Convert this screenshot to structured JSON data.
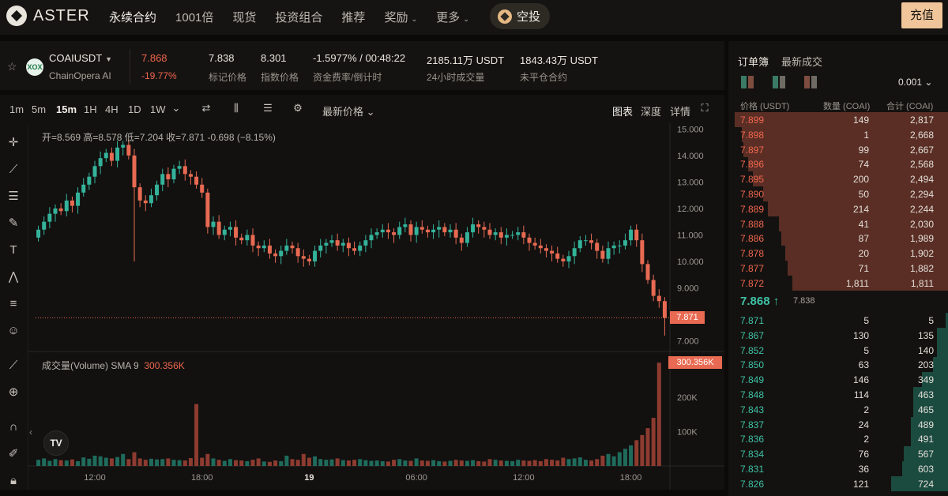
{
  "nav": {
    "logo": "ASTER",
    "items": [
      "永续合约",
      "1001倍",
      "现货",
      "投资组合",
      "推荐",
      "奖励",
      "更多"
    ],
    "airdrop": "空投",
    "deposit": "充值"
  },
  "ticker": {
    "symbol": "COAIUSDT",
    "name": "ChainOpera AI",
    "coin_icon": "XOX",
    "last_price": "7.868",
    "change_pct": "-19.77%",
    "mark_price": "7.838",
    "mark_label": "标记价格",
    "index_price": "8.301",
    "index_label": "指数价格",
    "funding": "-1.5977% / 00:48:22",
    "funding_label": "资金费率/倒计时",
    "volume_24h": "2185.11万 USDT",
    "volume_label": "24小时成交量",
    "open_interest": "1843.43万 USDT",
    "oi_label": "未平仓合约"
  },
  "toolbar": {
    "timeframes": [
      "1m",
      "5m",
      "15m",
      "1H",
      "4H",
      "1D",
      "1W"
    ],
    "active_timeframe": "15m",
    "price_type": "最新价格",
    "views": [
      "图表",
      "深度",
      "详情"
    ]
  },
  "chart": {
    "ohlc_text": "开=8.569 高=8.578 低=7.204 收=7.871 -0.698 (−8.15%)",
    "volume_text": "成交量(Volume) SMA 9",
    "volume_value": "300.356K",
    "last_price_tag": "7.871",
    "volume_tag": "300.356K"
  },
  "chart_data": {
    "type": "candlestick",
    "y_ticks": [
      "15.000",
      "14.000",
      "13.000",
      "12.000",
      "11.000",
      "10.000",
      "9.000",
      "7.000"
    ],
    "y_tick_values": [
      15,
      14,
      13,
      12,
      11,
      10,
      9,
      7
    ],
    "ylim": [
      6.6,
      15.1
    ],
    "x_ticks": [
      "12:00",
      "18:00",
      "19",
      "06:00",
      "12:00",
      "18:00"
    ],
    "x_tick_index": [
      10,
      29,
      48,
      67,
      86,
      105
    ],
    "vol_ticks": [
      "200K",
      "100K"
    ],
    "vol_tick_values": [
      200000,
      100000
    ],
    "vol_max": 310000,
    "closes": [
      11.2,
      11.5,
      11.8,
      12.0,
      11.9,
      12.3,
      12.1,
      12.6,
      12.9,
      13.2,
      13.6,
      13.9,
      14.1,
      13.8,
      14.3,
      14.4,
      14.0,
      12.8,
      12.3,
      12.2,
      12.5,
      12.9,
      13.3,
      13.1,
      13.5,
      13.6,
      13.3,
      13.2,
      12.9,
      12.6,
      11.3,
      11.5,
      11.0,
      11.2,
      11.3,
      10.9,
      10.8,
      11.0,
      10.6,
      10.5,
      10.6,
      10.3,
      10.2,
      10.4,
      10.6,
      10.5,
      10.2,
      10.1,
      10.0,
      10.4,
      10.6,
      10.7,
      10.8,
      10.6,
      10.7,
      10.5,
      10.4,
      10.6,
      10.8,
      11.0,
      11.1,
      11.2,
      11.1,
      11.0,
      11.3,
      11.4,
      11.0,
      11.3,
      11.2,
      11.1,
      11.2,
      11.3,
      11.1,
      11.2,
      10.9,
      10.7,
      11.1,
      11.4,
      11.3,
      11.2,
      11.0,
      11.1,
      10.9,
      11.0,
      11.0,
      11.1,
      10.9,
      10.7,
      10.6,
      10.5,
      10.4,
      10.3,
      10.1,
      10.0,
      10.2,
      10.5,
      10.8,
      10.8,
      10.7,
      10.4,
      10.1,
      10.5,
      10.6,
      10.6,
      10.8,
      11.2,
      10.8,
      9.9,
      9.3,
      8.7,
      8.5,
      7.87
    ],
    "volumes": [
      18000,
      22000,
      15000,
      20000,
      17000,
      16000,
      19000,
      14000,
      25000,
      21000,
      30000,
      28000,
      24000,
      22000,
      26000,
      35000,
      20000,
      40000,
      22000,
      18000,
      21000,
      19000,
      20000,
      22000,
      18000,
      17000,
      16000,
      23000,
      180000,
      24000,
      35000,
      22000,
      18000,
      15000,
      20000,
      17000,
      16000,
      14000,
      18000,
      22000,
      13000,
      12000,
      16000,
      14000,
      30000,
      20000,
      18000,
      35000,
      24000,
      28000,
      20000,
      18000,
      19000,
      22000,
      17000,
      16000,
      18000,
      20000,
      17000,
      15000,
      16000,
      14000,
      13000,
      18000,
      20000,
      16000,
      15000,
      22000,
      16000,
      15000,
      17000,
      14000,
      13000,
      15000,
      18000,
      16000,
      15000,
      17000,
      14000,
      13000,
      20000,
      18000,
      16000,
      15000,
      14000,
      18000,
      16000,
      15000,
      17000,
      14000,
      20000,
      18000,
      16000,
      24000,
      20000,
      22000,
      25000,
      18000,
      16000,
      20000,
      30000,
      35000,
      28000,
      40000,
      50000,
      60000,
      75000,
      90000,
      110000,
      140000,
      300356
    ]
  },
  "orderbook": {
    "tabs": [
      "订单簿",
      "最新成交"
    ],
    "tick_size": "0.001",
    "headers": [
      "价格 (USDT)",
      "数量 (COAI)",
      "合计 (COAI)"
    ],
    "asks": [
      {
        "price": "7.899",
        "qty": "149",
        "total": "2,817",
        "depth": 0.97
      },
      {
        "price": "7.898",
        "qty": "1",
        "total": "2,668",
        "depth": 0.94
      },
      {
        "price": "7.897",
        "qty": "99",
        "total": "2,667",
        "depth": 0.93
      },
      {
        "price": "7.896",
        "qty": "74",
        "total": "2,568",
        "depth": 0.91
      },
      {
        "price": "7.895",
        "qty": "200",
        "total": "2,494",
        "depth": 0.89
      },
      {
        "price": "7.890",
        "qty": "50",
        "total": "2,294",
        "depth": 0.84
      },
      {
        "price": "7.889",
        "qty": "214",
        "total": "2,244",
        "depth": 0.82
      },
      {
        "price": "7.888",
        "qty": "41",
        "total": "2,030",
        "depth": 0.77
      },
      {
        "price": "7.886",
        "qty": "87",
        "total": "1,989",
        "depth": 0.76
      },
      {
        "price": "7.878",
        "qty": "20",
        "total": "1,902",
        "depth": 0.74
      },
      {
        "price": "7.877",
        "qty": "71",
        "total": "1,882",
        "depth": 0.73
      },
      {
        "price": "7.872",
        "qty": "1,811",
        "total": "1,811",
        "depth": 0.71
      }
    ],
    "mid_price": "7.868",
    "mid_arrow": "↑",
    "mark_price": "7.838",
    "bids": [
      {
        "price": "7.871",
        "qty": "5",
        "total": "5",
        "depth": 0.01
      },
      {
        "price": "7.867",
        "qty": "130",
        "total": "135",
        "depth": 0.05
      },
      {
        "price": "7.852",
        "qty": "5",
        "total": "140",
        "depth": 0.05
      },
      {
        "price": "7.850",
        "qty": "63",
        "total": "203",
        "depth": 0.07
      },
      {
        "price": "7.849",
        "qty": "146",
        "total": "349",
        "depth": 0.12
      },
      {
        "price": "7.848",
        "qty": "114",
        "total": "463",
        "depth": 0.16
      },
      {
        "price": "7.843",
        "qty": "2",
        "total": "465",
        "depth": 0.16
      },
      {
        "price": "7.837",
        "qty": "24",
        "total": "489",
        "depth": 0.17
      },
      {
        "price": "7.836",
        "qty": "2",
        "total": "491",
        "depth": 0.17
      },
      {
        "price": "7.834",
        "qty": "76",
        "total": "567",
        "depth": 0.2
      },
      {
        "price": "7.831",
        "qty": "36",
        "total": "603",
        "depth": 0.21
      },
      {
        "price": "7.826",
        "qty": "121",
        "total": "724",
        "depth": 0.26
      }
    ]
  }
}
